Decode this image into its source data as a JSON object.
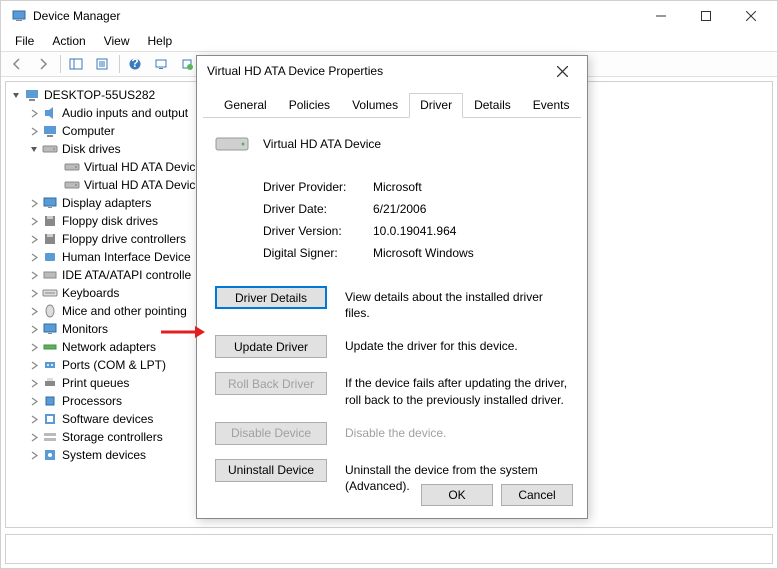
{
  "window": {
    "title": "Device Manager",
    "menu": [
      "File",
      "Action",
      "View",
      "Help"
    ]
  },
  "tree": {
    "root": "DESKTOP-55US282",
    "nodes": [
      {
        "label": "Audio inputs and output",
        "icon": "audio"
      },
      {
        "label": "Computer",
        "icon": "computer"
      },
      {
        "label": "Disk drives",
        "icon": "drive",
        "expanded": true,
        "children": [
          {
            "label": "Virtual HD ATA Devic",
            "icon": "drive"
          },
          {
            "label": "Virtual HD ATA Devic",
            "icon": "drive"
          }
        ]
      },
      {
        "label": "Display adapters",
        "icon": "display"
      },
      {
        "label": "Floppy disk drives",
        "icon": "floppy"
      },
      {
        "label": "Floppy drive controllers",
        "icon": "floppy"
      },
      {
        "label": "Human Interface Device",
        "icon": "hid"
      },
      {
        "label": "IDE ATA/ATAPI controlle",
        "icon": "ide"
      },
      {
        "label": "Keyboards",
        "icon": "keyboard"
      },
      {
        "label": "Mice and other pointing",
        "icon": "mouse"
      },
      {
        "label": "Monitors",
        "icon": "monitor"
      },
      {
        "label": "Network adapters",
        "icon": "network"
      },
      {
        "label": "Ports (COM & LPT)",
        "icon": "port"
      },
      {
        "label": "Print queues",
        "icon": "printer"
      },
      {
        "label": "Processors",
        "icon": "cpu"
      },
      {
        "label": "Software devices",
        "icon": "software"
      },
      {
        "label": "Storage controllers",
        "icon": "storage"
      },
      {
        "label": "System devices",
        "icon": "system"
      }
    ]
  },
  "dialog": {
    "title": "Virtual HD ATA Device Properties",
    "tabs": [
      "General",
      "Policies",
      "Volumes",
      "Driver",
      "Details",
      "Events"
    ],
    "activeTab": "Driver",
    "deviceName": "Virtual HD ATA Device",
    "info": {
      "providerLabel": "Driver Provider:",
      "provider": "Microsoft",
      "dateLabel": "Driver Date:",
      "date": "6/21/2006",
      "versionLabel": "Driver Version:",
      "version": "10.0.19041.964",
      "signerLabel": "Digital Signer:",
      "signer": "Microsoft Windows"
    },
    "actions": {
      "details": {
        "label": "Driver Details",
        "desc": "View details about the installed driver files."
      },
      "update": {
        "label": "Update Driver",
        "desc": "Update the driver for this device."
      },
      "rollback": {
        "label": "Roll Back Driver",
        "desc": "If the device fails after updating the driver, roll back to the previously installed driver."
      },
      "disable": {
        "label": "Disable Device",
        "desc": "Disable the device."
      },
      "uninstall": {
        "label": "Uninstall Device",
        "desc": "Uninstall the device from the system (Advanced)."
      }
    },
    "buttons": {
      "ok": "OK",
      "cancel": "Cancel"
    }
  }
}
